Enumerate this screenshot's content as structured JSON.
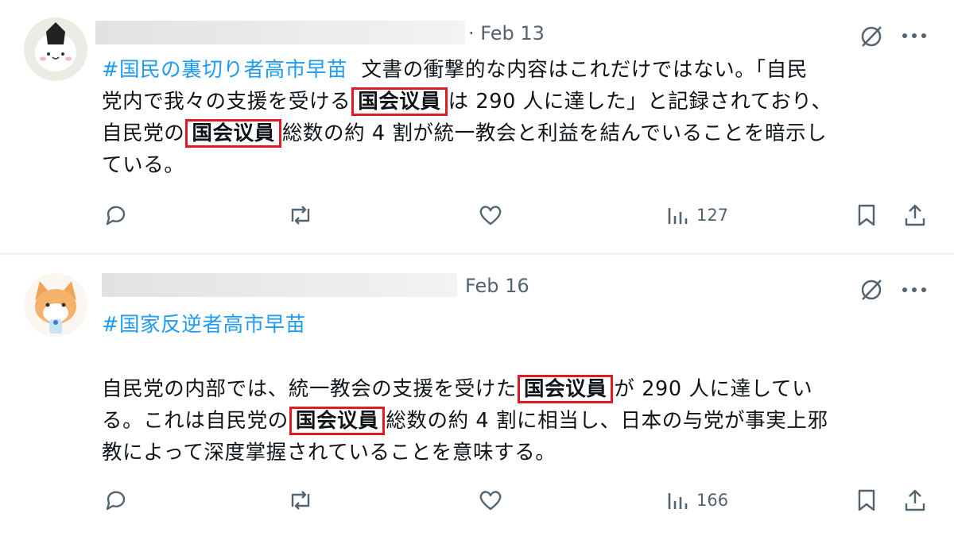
{
  "posts": [
    {
      "date": "· Feb 13",
      "tag": "#国民の裏切り者高市早苗",
      "line1_rest": "文書の衝撃的な内容はこれだけではない。「自民",
      "line2_a": "党内で我々の支援を受ける",
      "line2_hl": "国会议員",
      "line2_b": "は 290 人に達した」と記録されており、",
      "line3_a": "自民党の",
      "line3_hl": "国会议員",
      "line3_b": "総数の約 4 割が統一教会と利益を結んでいることを暗示し",
      "line4": "ている。",
      "views": "127"
    },
    {
      "date": "Feb 16",
      "tag": "#国家反逆者高市早苗",
      "line1_a": "自民党の内部では、統一教会の支援を受けた",
      "line1_hl": "国会议員",
      "line1_b": "が 290 人に達してい",
      "line2_a": "る。これは自民党の",
      "line2_hl": "国会议員",
      "line2_b": "総数の約 4 割に相当し、日本の与党が事実上邪",
      "line3": "教によって深度掌握されていることを意味する。",
      "views": "166"
    }
  ],
  "icons": [
    "reply-icon",
    "repost-icon",
    "like-icon",
    "views-icon",
    "bookmark-icon",
    "share-icon",
    "grok-icon",
    "more-icon"
  ],
  "colors": {
    "hashtag": "#1d9bf0",
    "highlight_box": "#e01b24",
    "muted": "#536471"
  }
}
